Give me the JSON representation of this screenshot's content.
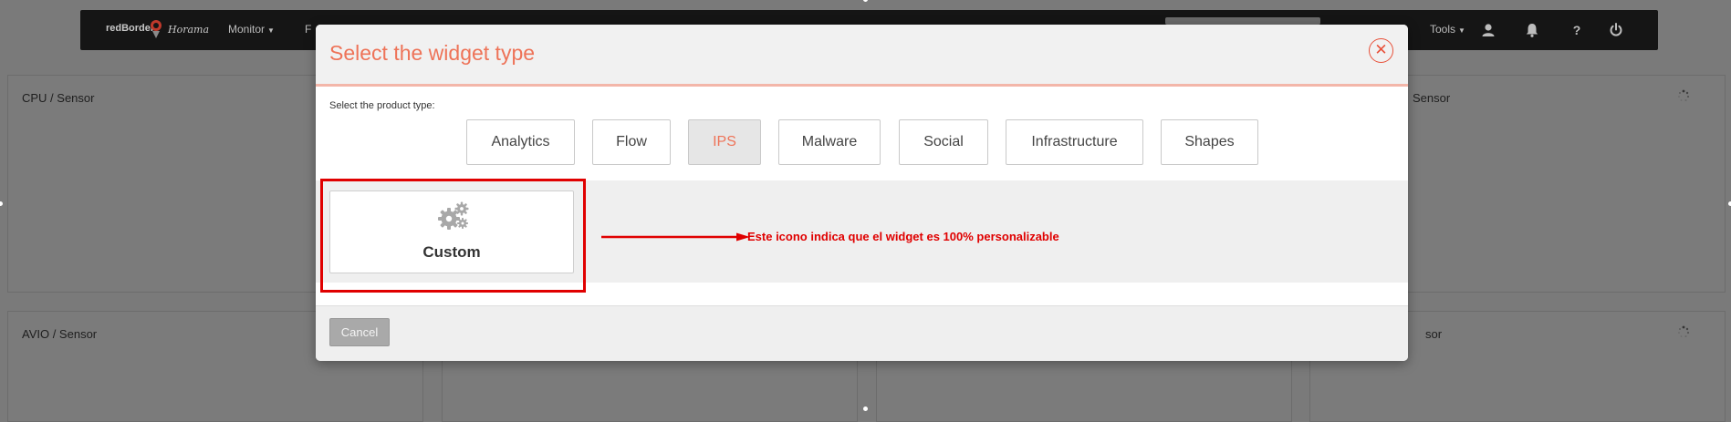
{
  "navbar": {
    "brand": "redBorder",
    "brand_sub": "Horama",
    "items": [
      {
        "label": "Monitor"
      },
      {
        "label": "F"
      }
    ],
    "tools_label": "Tools",
    "icons": [
      "user-icon",
      "bell-icon",
      "help-icon",
      "power-icon"
    ]
  },
  "panels": [
    {
      "title": "CPU / Sensor"
    },
    {
      "title": "Sensor"
    },
    {
      "title": "AVIO / Sensor"
    },
    {
      "title": "sor"
    }
  ],
  "modal": {
    "title": "Select the widget type",
    "close_glyph": "✕",
    "product_label": "Select the product type:",
    "product_types": [
      {
        "label": "Analytics",
        "active": false
      },
      {
        "label": "Flow",
        "active": false
      },
      {
        "label": "IPS",
        "active": true
      },
      {
        "label": "Malware",
        "active": false
      },
      {
        "label": "Social",
        "active": false
      },
      {
        "label": "Infrastructure",
        "active": false
      },
      {
        "label": "Shapes",
        "active": false
      }
    ],
    "widgets": [
      {
        "label": "Custom",
        "icon": "gears-icon"
      }
    ],
    "annotation": "Este icono indica que el widget es 100% personalizable",
    "cancel_label": "Cancel"
  },
  "colors": {
    "accent": "#ee7358",
    "annotation_red": "#e00000",
    "overlay": "#7a7a7a",
    "navbar": "#151515"
  }
}
